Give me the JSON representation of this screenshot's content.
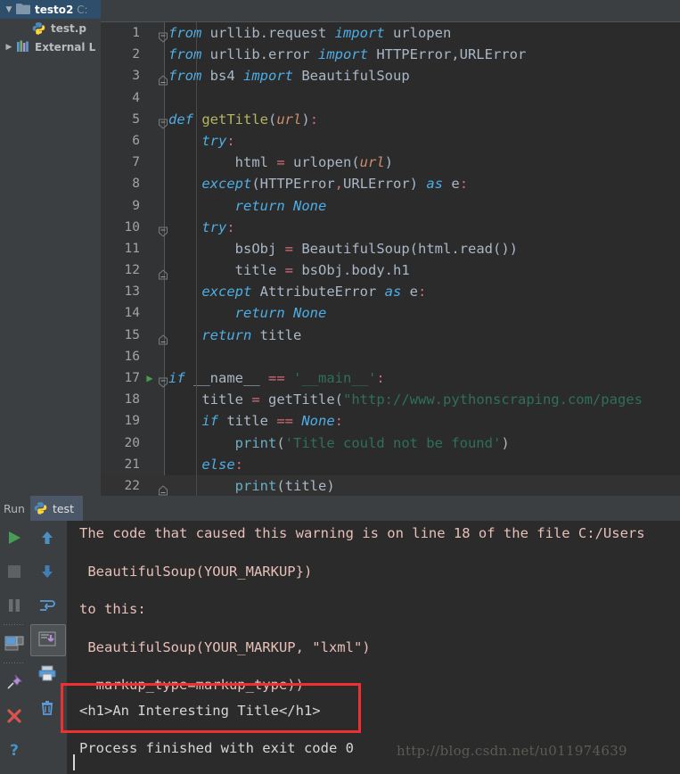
{
  "project": {
    "items": [
      {
        "arrow": "▼",
        "icon": "folder-icon",
        "label": "testo2",
        "path": " C:",
        "selected": true,
        "indent": 0
      },
      {
        "arrow": "",
        "icon": "python-file-icon",
        "label": "test.p",
        "path": "",
        "selected": false,
        "indent": 1
      },
      {
        "arrow": "▶",
        "icon": "library-icon",
        "label": "External L",
        "path": "",
        "selected": false,
        "indent": 0
      }
    ]
  },
  "editor": {
    "lines": [
      {
        "num": "1",
        "fold": "minus-square",
        "run": "",
        "current": false,
        "tokens": [
          {
            "t": "from",
            "c": "pykw"
          },
          {
            "t": " urllib.request ",
            "c": "ident"
          },
          {
            "t": "import",
            "c": "pykw"
          },
          {
            "t": " urlopen",
            "c": "ident"
          }
        ]
      },
      {
        "num": "2",
        "fold": "",
        "run": "",
        "current": false,
        "tokens": [
          {
            "t": "from",
            "c": "pykw"
          },
          {
            "t": " urllib.error ",
            "c": "ident"
          },
          {
            "t": "import",
            "c": "pykw"
          },
          {
            "t": " HTTPError,URLError",
            "c": "ident"
          }
        ]
      },
      {
        "num": "3",
        "fold": "end-fold",
        "run": "",
        "current": false,
        "tokens": [
          {
            "t": "from",
            "c": "pykw"
          },
          {
            "t": " bs4 ",
            "c": "ident"
          },
          {
            "t": "import",
            "c": "pykw"
          },
          {
            "t": " BeautifulSoup",
            "c": "ident"
          }
        ]
      },
      {
        "num": "4",
        "fold": "",
        "run": "",
        "current": false,
        "tokens": []
      },
      {
        "num": "5",
        "fold": "minus-square",
        "run": "",
        "current": false,
        "tokens": [
          {
            "t": "def",
            "c": "pykw"
          },
          {
            "t": " ",
            "c": "ident"
          },
          {
            "t": "getTitle",
            "c": "fn"
          },
          {
            "t": "(",
            "c": "punct"
          },
          {
            "t": "url",
            "c": "param"
          },
          {
            "t": ")",
            "c": "punct"
          },
          {
            "t": ":",
            "c": "op"
          }
        ]
      },
      {
        "num": "6",
        "fold": "",
        "run": "",
        "current": false,
        "tokens": [
          {
            "t": "    ",
            "c": "ident"
          },
          {
            "t": "try",
            "c": "pykw"
          },
          {
            "t": ":",
            "c": "op"
          }
        ]
      },
      {
        "num": "7",
        "fold": "",
        "run": "",
        "current": false,
        "tokens": [
          {
            "t": "        html ",
            "c": "ident"
          },
          {
            "t": "=",
            "c": "op"
          },
          {
            "t": " urlopen",
            "c": "ident"
          },
          {
            "t": "(",
            "c": "punct"
          },
          {
            "t": "url",
            "c": "param"
          },
          {
            "t": ")",
            "c": "punct"
          }
        ]
      },
      {
        "num": "8",
        "fold": "",
        "run": "",
        "current": false,
        "tokens": [
          {
            "t": "    ",
            "c": "ident"
          },
          {
            "t": "except",
            "c": "pykw"
          },
          {
            "t": "(",
            "c": "punct"
          },
          {
            "t": "HTTPError",
            "c": "ident"
          },
          {
            "t": ",",
            "c": "op"
          },
          {
            "t": "URLError",
            "c": "ident"
          },
          {
            "t": ") ",
            "c": "punct"
          },
          {
            "t": "as",
            "c": "pykw"
          },
          {
            "t": " e",
            "c": "ident"
          },
          {
            "t": ":",
            "c": "op"
          }
        ]
      },
      {
        "num": "9",
        "fold": "",
        "run": "",
        "current": false,
        "tokens": [
          {
            "t": "        ",
            "c": "ident"
          },
          {
            "t": "return",
            "c": "pykw"
          },
          {
            "t": " ",
            "c": "ident"
          },
          {
            "t": "None",
            "c": "none"
          }
        ]
      },
      {
        "num": "10",
        "fold": "minus-square",
        "run": "",
        "current": false,
        "tokens": [
          {
            "t": "    ",
            "c": "ident"
          },
          {
            "t": "try",
            "c": "pykw"
          },
          {
            "t": ":",
            "c": "op"
          }
        ]
      },
      {
        "num": "11",
        "fold": "",
        "run": "",
        "current": false,
        "tokens": [
          {
            "t": "        bsObj ",
            "c": "ident"
          },
          {
            "t": "=",
            "c": "op"
          },
          {
            "t": " BeautifulSoup",
            "c": "ident"
          },
          {
            "t": "(",
            "c": "punct"
          },
          {
            "t": "html.read",
            "c": "ident"
          },
          {
            "t": "())",
            "c": "punct"
          }
        ]
      },
      {
        "num": "12",
        "fold": "end-fold",
        "run": "",
        "current": false,
        "tokens": [
          {
            "t": "        title ",
            "c": "ident"
          },
          {
            "t": "=",
            "c": "op"
          },
          {
            "t": " bsObj.body.h1",
            "c": "ident"
          }
        ]
      },
      {
        "num": "13",
        "fold": "",
        "run": "",
        "current": false,
        "tokens": [
          {
            "t": "    ",
            "c": "ident"
          },
          {
            "t": "except",
            "c": "pykw"
          },
          {
            "t": " AttributeError ",
            "c": "ident"
          },
          {
            "t": "as",
            "c": "pykw"
          },
          {
            "t": " e",
            "c": "ident"
          },
          {
            "t": ":",
            "c": "op"
          }
        ]
      },
      {
        "num": "14",
        "fold": "",
        "run": "",
        "current": false,
        "tokens": [
          {
            "t": "        ",
            "c": "ident"
          },
          {
            "t": "return",
            "c": "pykw"
          },
          {
            "t": " ",
            "c": "ident"
          },
          {
            "t": "None",
            "c": "none"
          }
        ]
      },
      {
        "num": "15",
        "fold": "end-fold",
        "run": "",
        "current": false,
        "tokens": [
          {
            "t": "    ",
            "c": "ident"
          },
          {
            "t": "return",
            "c": "pykw"
          },
          {
            "t": " title",
            "c": "ident"
          }
        ]
      },
      {
        "num": "16",
        "fold": "",
        "run": "",
        "current": false,
        "tokens": []
      },
      {
        "num": "17",
        "fold": "minus-square",
        "run": "▶",
        "current": false,
        "tokens": [
          {
            "t": "if",
            "c": "pykw"
          },
          {
            "t": " __name__ ",
            "c": "ident"
          },
          {
            "t": "==",
            "c": "op"
          },
          {
            "t": " ",
            "c": "ident"
          },
          {
            "t": "'__main__'",
            "c": "str"
          },
          {
            "t": ":",
            "c": "op"
          }
        ]
      },
      {
        "num": "18",
        "fold": "",
        "run": "",
        "current": false,
        "tokens": [
          {
            "t": "    title ",
            "c": "ident"
          },
          {
            "t": "=",
            "c": "op"
          },
          {
            "t": " getTitle",
            "c": "ident"
          },
          {
            "t": "(",
            "c": "punct"
          },
          {
            "t": "\"http://www.pythonscraping.com/pages",
            "c": "str"
          }
        ]
      },
      {
        "num": "19",
        "fold": "",
        "run": "",
        "current": false,
        "tokens": [
          {
            "t": "    ",
            "c": "ident"
          },
          {
            "t": "if",
            "c": "pykw"
          },
          {
            "t": " title ",
            "c": "ident"
          },
          {
            "t": "==",
            "c": "op"
          },
          {
            "t": " ",
            "c": "ident"
          },
          {
            "t": "None",
            "c": "none"
          },
          {
            "t": ":",
            "c": "op"
          }
        ]
      },
      {
        "num": "20",
        "fold": "",
        "run": "",
        "current": false,
        "tokens": [
          {
            "t": "        ",
            "c": "ident"
          },
          {
            "t": "print",
            "c": "bltn"
          },
          {
            "t": "(",
            "c": "punct"
          },
          {
            "t": "'Title could not be found'",
            "c": "str"
          },
          {
            "t": ")",
            "c": "punct"
          }
        ]
      },
      {
        "num": "21",
        "fold": "",
        "run": "",
        "current": false,
        "tokens": [
          {
            "t": "    ",
            "c": "ident"
          },
          {
            "t": "else",
            "c": "pykw"
          },
          {
            "t": ":",
            "c": "op"
          }
        ]
      },
      {
        "num": "22",
        "fold": "end-fold",
        "run": "",
        "current": true,
        "tokens": [
          {
            "t": "        ",
            "c": "ident"
          },
          {
            "t": "print",
            "c": "bltn"
          },
          {
            "t": "(",
            "c": "punct"
          },
          {
            "t": "title",
            "c": "ident"
          },
          {
            "t": ")",
            "c": "punct"
          }
        ]
      }
    ]
  },
  "run": {
    "label": "Run",
    "tab_label": "test",
    "toolbar_left": [
      {
        "name": "run-button",
        "icon": "play-icon"
      },
      {
        "name": "stop-button",
        "icon": "stop-icon"
      },
      {
        "name": "pause-button",
        "icon": "pause-icon"
      },
      {
        "name": "restore-layout-button",
        "icon": "monitor-icon"
      },
      {
        "name": "pin-tab-button",
        "icon": "pin-icon"
      },
      {
        "name": "close-button",
        "icon": "close-x-icon"
      },
      {
        "name": "help-button",
        "icon": "question-mark-icon"
      }
    ],
    "toolbar_right": [
      {
        "name": "up-the-stack-trace-button",
        "icon": "arrow-up-icon"
      },
      {
        "name": "down-the-stack-trace-button",
        "icon": "arrow-down-icon"
      },
      {
        "name": "soft-wrap-button",
        "icon": "soft-wrap-icon"
      },
      {
        "name": "scroll-to-end-button",
        "icon": "scroll-to-end-icon"
      },
      {
        "name": "print-button",
        "icon": "printer-icon"
      },
      {
        "name": "clear-all-button",
        "icon": "trash-icon"
      }
    ]
  },
  "console": {
    "lines": [
      {
        "text": "The code that caused this warning is on line 18 of the file C:/Users",
        "style": "err"
      },
      {
        "text": "",
        "style": "blank"
      },
      {
        "text": " BeautifulSoup(YOUR_MARKUP})",
        "style": "err"
      },
      {
        "text": "",
        "style": "blank"
      },
      {
        "text": "to this:",
        "style": "err"
      },
      {
        "text": "",
        "style": "blank"
      },
      {
        "text": " BeautifulSoup(YOUR_MARKUP, \"lxml\")",
        "style": "err"
      },
      {
        "text": "",
        "style": "blank"
      },
      {
        "text": "  markup_type=markup_type))",
        "style": "err"
      },
      {
        "text": "<h1>An Interesting Title</h1>",
        "style": "white"
      },
      {
        "text": "",
        "style": "blank"
      },
      {
        "text": "Process finished with exit code 0",
        "style": "white"
      }
    ]
  },
  "watermark": {
    "text": "http://blog.csdn.net/u011974639"
  },
  "colors": {
    "editor_bg": "#2b2b2b",
    "panel_bg": "#3c3f41",
    "accent_red": "#f03030",
    "selection_blue": "#2d4f6c",
    "console_err": "#e8bfb9",
    "keyword": "#4eade5",
    "string": "#2e6f5e"
  }
}
